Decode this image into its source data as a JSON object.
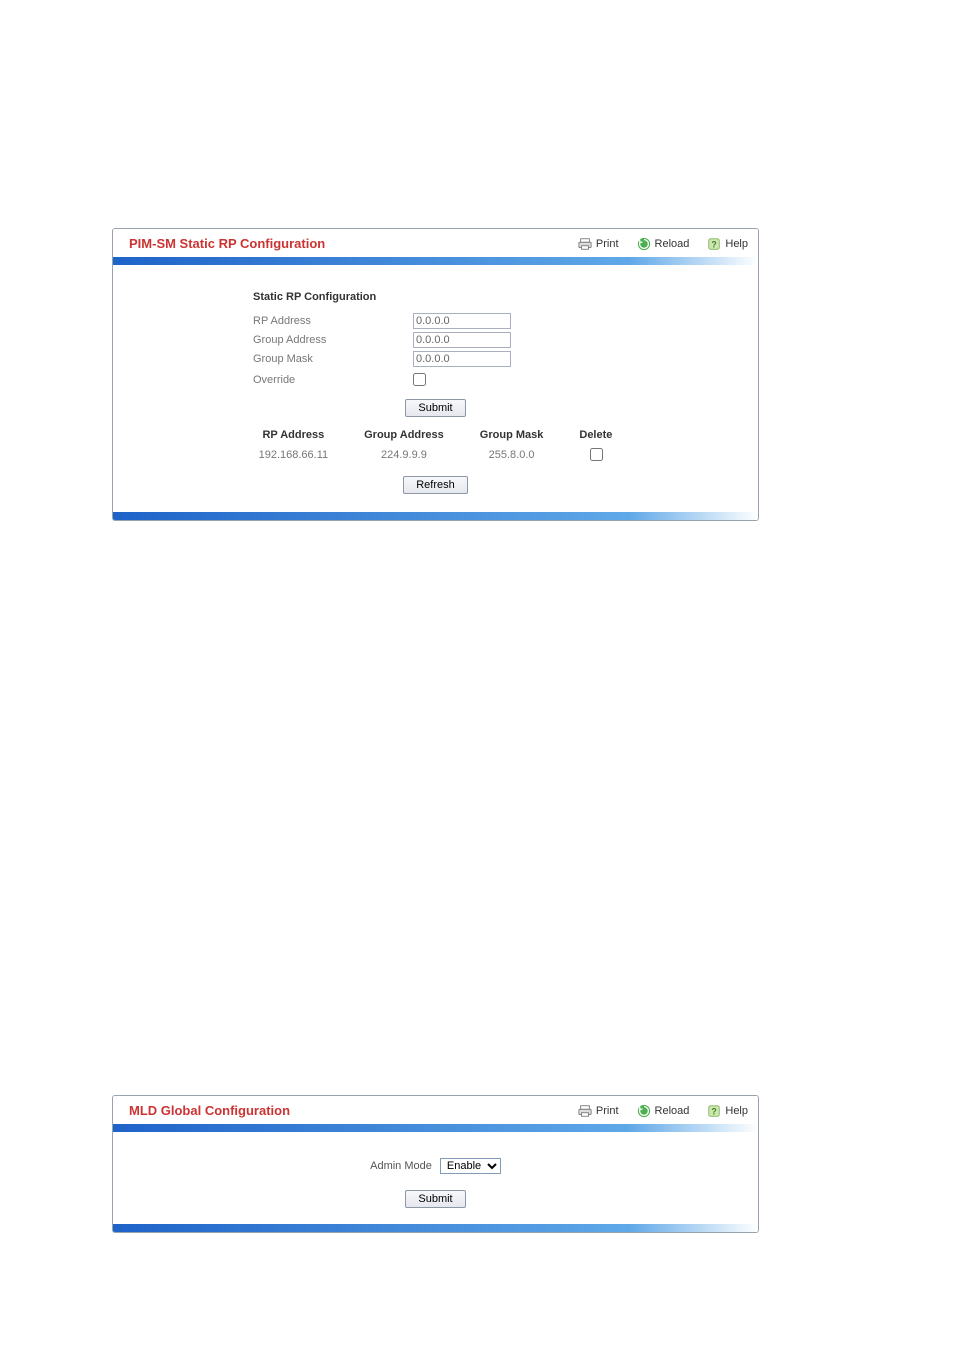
{
  "toolbar": {
    "print": "Print",
    "reload": "Reload",
    "help": "Help"
  },
  "panel1": {
    "title": "PIM-SM Static RP Configuration",
    "section": "Static RP Configuration",
    "fields": {
      "rp_address_label": "RP Address",
      "rp_address_value": "0.0.0.0",
      "group_address_label": "Group Address",
      "group_address_value": "0.0.0.0",
      "group_mask_label": "Group Mask",
      "group_mask_value": "0.0.0.0",
      "override_label": "Override"
    },
    "buttons": {
      "submit": "Submit",
      "refresh": "Refresh"
    },
    "table": {
      "headers": {
        "rp_address": "RP Address",
        "group_address": "Group Address",
        "group_mask": "Group Mask",
        "delete": "Delete"
      },
      "rows": [
        {
          "rp_address": "192.168.66.11",
          "group_address": "224.9.9.9",
          "group_mask": "255.8.0.0"
        }
      ]
    }
  },
  "panel2": {
    "title": "MLD Global Configuration",
    "field": {
      "admin_mode_label": "Admin Mode",
      "admin_mode_value": "Enable"
    },
    "buttons": {
      "submit": "Submit"
    }
  }
}
